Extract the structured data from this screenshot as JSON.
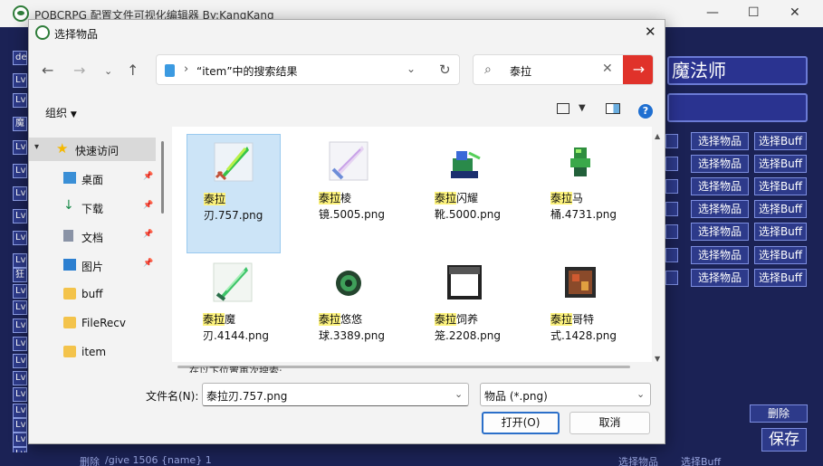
{
  "main": {
    "title": "POBCRPG 配置文件可视化编辑器 By:KangKang",
    "left_items": [
      "de",
      "Lv",
      "Lv",
      "魔",
      "Lv",
      "Lv",
      "Lv",
      "Lv",
      "Lv",
      "Lv",
      "狂",
      "Lv",
      "Lv",
      "Lv",
      "Lv",
      "Lv",
      "Lv",
      "Lv",
      "Lv",
      "Lv",
      "Lv",
      "Lv"
    ],
    "class_name": "魔法师",
    "select_item_label": "选择物品",
    "select_buff_label": "选择Buff",
    "delete_label": "删除",
    "save_label": "保存",
    "bottom_left": "删除",
    "bottom_cmd": "/give 1506 {name} 1",
    "bottom_btn1": "选择物品",
    "bottom_btn2": "选择Buff"
  },
  "dialog": {
    "title": "选择物品",
    "address": "“item”中的搜索结果",
    "search_value": "泰拉",
    "organize": "组织",
    "nav": {
      "quick_access": "快速访问",
      "items": [
        "桌面",
        "下载",
        "文档",
        "图片",
        "buff",
        "FileRecv",
        "item"
      ]
    },
    "files": [
      {
        "hl": "泰拉",
        "line1_rest": "",
        "line2": "刃.757.png",
        "selected": true
      },
      {
        "hl": "泰拉",
        "line1_rest": "棱",
        "line2": "镜.5005.png"
      },
      {
        "hl": "泰拉",
        "line1_rest": "闪耀",
        "line2": "靴.5000.png"
      },
      {
        "hl": "泰拉",
        "line1_rest": "马",
        "line2": "桶.4731.png"
      },
      {
        "hl": "泰拉",
        "line1_rest": "魔",
        "line2": "刃.4144.png"
      },
      {
        "hl": "泰拉",
        "line1_rest": "悠悠",
        "line2": "球.3389.png"
      },
      {
        "hl": "泰拉",
        "line1_rest": "饲养",
        "line2": "笼.2208.png"
      },
      {
        "hl": "泰拉",
        "line1_rest": "哥特",
        "line2": "式.1428.png"
      }
    ],
    "search_again": "在以下位置再次搜索:",
    "filename_label": "文件名(N):",
    "filename_value": "泰拉刃.757.png",
    "filetype_value": "物品 (*.png)",
    "open_label": "打开(O)",
    "cancel_label": "取消"
  }
}
